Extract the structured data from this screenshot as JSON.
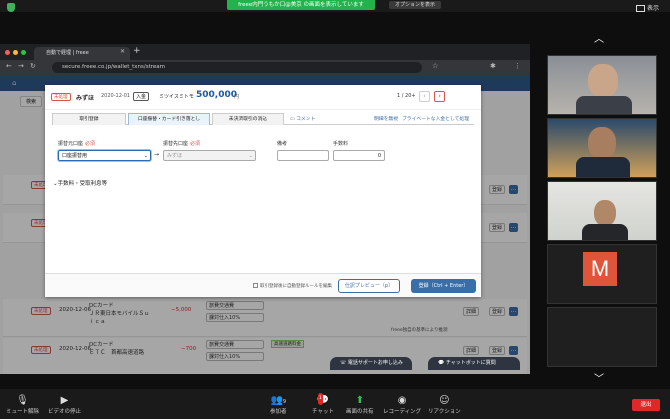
{
  "zoom": {
    "share_banner": "freee内門うもか口@美京 の画面を表示しています",
    "view_options": "オプションを表示",
    "view_label": "表示"
  },
  "browser": {
    "tab_title": "自動で経理 | freee",
    "url": "secure.freee.co.jp/wallet_txns/stream"
  },
  "bg_list": {
    "search_button": "検索",
    "status": "未処理",
    "register": "登録",
    "more": "…",
    "rows": [
      {
        "date": "2020-12-06",
        "desc1": "DCカード",
        "desc2": "ＪＲ東日本モバイルＳｕ",
        "desc3": "ｉｃａ",
        "amount": "−5,000",
        "account": "旅費交通費",
        "tax": "課対仕入10%",
        "detail": "詳細"
      },
      {
        "date": "2020-12-06",
        "desc1": "DCカード",
        "desc2": "ＥＴＣ　首都高速道路",
        "desc3": "",
        "amount": "−700",
        "account": "旅費交通費",
        "tax": "課対仕入10%",
        "detail": "詳細"
      }
    ],
    "rule_note": "freee独自の基準により推測",
    "tag_note": "高速道路料金"
  },
  "modal": {
    "status": "未処理",
    "bank": "みずほ",
    "date": "2020-12-01",
    "type": "入金",
    "payee": "ミツイスミトモ",
    "amount": "500,000",
    "yen": "円",
    "page": "1 / 20+",
    "prev": "‹",
    "next": "›",
    "tabs": [
      "取引登録",
      "口座振替・カード引き落とし",
      "未決済取引の消込"
    ],
    "comment_link": "コメント",
    "delete_link": "明細を無視",
    "private_link": "プライベートな入金として処理",
    "from_label": "振替元口座",
    "to_label": "振替先口座",
    "required": "必須",
    "from_value": "口座振替用",
    "to_value": "みずほ",
    "memo_label": "備考",
    "fee_label": "手数料",
    "fee_value": "0",
    "fee_toggle": "手数料・受取利息等",
    "rule_check": "取引登録後に自動登録ルールを編集",
    "preview_button": "仕訳プレビュー（p）",
    "register_button": "登録（Ctrl + Enter）"
  },
  "support": {
    "phone": "電話サポートお申し込み",
    "chatbot": "チャットボットに質問"
  },
  "gallery": {
    "avatar_letter": "M"
  },
  "toolbar": {
    "mute": "ミュート解除",
    "video": "ビデオの停止",
    "participants": "参加者",
    "participants_count": "9",
    "chat": "チャット",
    "chat_badge": "1",
    "share": "画面の共有",
    "record": "レコーディング",
    "reaction": "リアクション",
    "leave": "退出"
  },
  "colors": {
    "accent": "#3a6ea8",
    "alert": "#d9534f",
    "zoom_green": "#23b24b",
    "leave_red": "#e02828"
  }
}
